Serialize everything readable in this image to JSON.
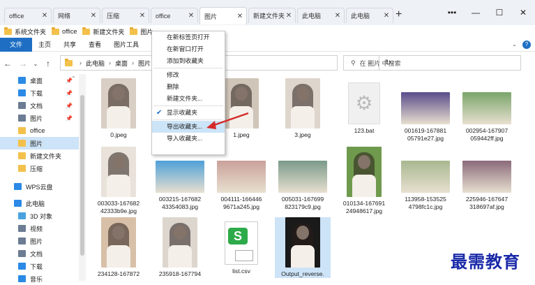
{
  "tabs": [
    {
      "label": "office"
    },
    {
      "label": "网络"
    },
    {
      "label": "压缩"
    },
    {
      "label": "office"
    },
    {
      "label": "图片",
      "active": true
    },
    {
      "label": "新建文件夹"
    },
    {
      "label": "此电脑"
    },
    {
      "label": "此电脑"
    }
  ],
  "window": {
    "more": "•••",
    "minimize": "—",
    "maximize": "☐",
    "close": "✕",
    "new_tab": "+"
  },
  "favorites": [
    {
      "label": "系统文件夹"
    },
    {
      "label": "office"
    },
    {
      "label": "新建文件夹"
    },
    {
      "label": "图片"
    }
  ],
  "ribbon": {
    "file": "文件",
    "home": "主页",
    "share": "共享",
    "view": "查看",
    "picture_tools": "图片工具",
    "help": "?"
  },
  "address": {
    "crumbs": [
      "此电脑",
      "桌面",
      "图片"
    ],
    "search_placeholder": "在 图片 中搜索"
  },
  "sidebar": [
    {
      "label": "桌面",
      "pinned": true,
      "color": "#2b8ae6"
    },
    {
      "label": "下载",
      "pinned": true,
      "color": "#2b8ae6"
    },
    {
      "label": "文档",
      "pinned": true,
      "color": "#6b7c93"
    },
    {
      "label": "图片",
      "pinned": true,
      "color": "#6b7c93"
    },
    {
      "label": "office",
      "color": "#f3c14b"
    },
    {
      "label": "图片",
      "color": "#f3c14b",
      "selected": true
    },
    {
      "label": "新建文件夹",
      "color": "#f3c14b"
    },
    {
      "label": "压缩",
      "color": "#f3c14b"
    },
    {
      "label": "WPS云盘",
      "color": "#2b8ae6",
      "section": true
    },
    {
      "label": "此电脑",
      "color": "#2b8ae6",
      "section": true
    },
    {
      "label": "3D 对象",
      "color": "#4aa3df"
    },
    {
      "label": "视频",
      "color": "#6b7c93"
    },
    {
      "label": "图片",
      "color": "#6b7c93"
    },
    {
      "label": "文档",
      "color": "#6b7c93"
    },
    {
      "label": "下载",
      "color": "#2b8ae6"
    },
    {
      "label": "音乐",
      "color": "#2b8ae6"
    }
  ],
  "files": [
    {
      "name": "0.jpeg",
      "kind": "portrait",
      "bg": "#d9cfc4"
    },
    {
      "name": "1.jpeg",
      "kind": "portrait",
      "bg": "#cfc5b8"
    },
    {
      "name": "3.jpeg",
      "kind": "portrait",
      "bg": "#ded6cc"
    },
    {
      "name": "123.bat",
      "kind": "bat"
    },
    {
      "name": "001619-1678810 5791e27.jpg",
      "line1": "001619-167881",
      "line2": "05791e27.jpg",
      "kind": "land",
      "bg": "#5a4c8a"
    },
    {
      "line1": "002954-167907",
      "line2": "059442ff.jpg",
      "kind": "land",
      "bg": "#7aa56a"
    },
    {
      "line1": "003033-167682",
      "line2": "42333b9e.jpg",
      "kind": "portrait",
      "bg": "#e8e2da"
    },
    {
      "line1": "003215-167682",
      "line2": "43354083.jpg",
      "kind": "land",
      "bg": "#4fa0d8"
    },
    {
      "line1": "004111-166446",
      "line2": "9671a245.jpg",
      "kind": "land",
      "bg": "#c9a09a"
    },
    {
      "line1": "005031-167699",
      "line2": "823179c9.jpg",
      "kind": "land",
      "bg": "#7a9a8a"
    },
    {
      "line1": "010134-167691",
      "line2": "24948617.jpg",
      "kind": "portrait",
      "bg": "#6f9a4e"
    },
    {
      "line1": "113958-153525",
      "line2": "4798fc1c.jpg",
      "kind": "land",
      "bg": "#a8b890"
    },
    {
      "line1": "225946-167647",
      "line2": "318697af.jpg",
      "kind": "land",
      "bg": "#8a6a7a"
    },
    {
      "line1": "234128-167872",
      "kind": "portrait",
      "bg": "#d8c0a8"
    },
    {
      "line1": "235918-167794",
      "kind": "portrait",
      "bg": "#dcd6cf"
    },
    {
      "line1": "list.csv",
      "kind": "csv"
    },
    {
      "line1": "Output_reverse.",
      "kind": "portrait",
      "bg": "#1a1a1a",
      "selected": true
    }
  ],
  "context_menu": [
    {
      "label": "在新标签页打开"
    },
    {
      "label": "在新窗口打开"
    },
    {
      "label": "添加到收藏夹"
    },
    {
      "sep": true
    },
    {
      "label": "修改"
    },
    {
      "label": "删除"
    },
    {
      "label": "新建文件夹..."
    },
    {
      "sep": true
    },
    {
      "label": "显示收藏夹",
      "checked": true
    },
    {
      "sep": true
    },
    {
      "label": "导出收藏夹...",
      "highlighted": true
    },
    {
      "label": "导入收藏夹..."
    }
  ],
  "watermark": "最需教育",
  "colors": {
    "accent": "#1e6fc3",
    "arrow": "#d42a2a",
    "selection": "#cde3f7"
  }
}
